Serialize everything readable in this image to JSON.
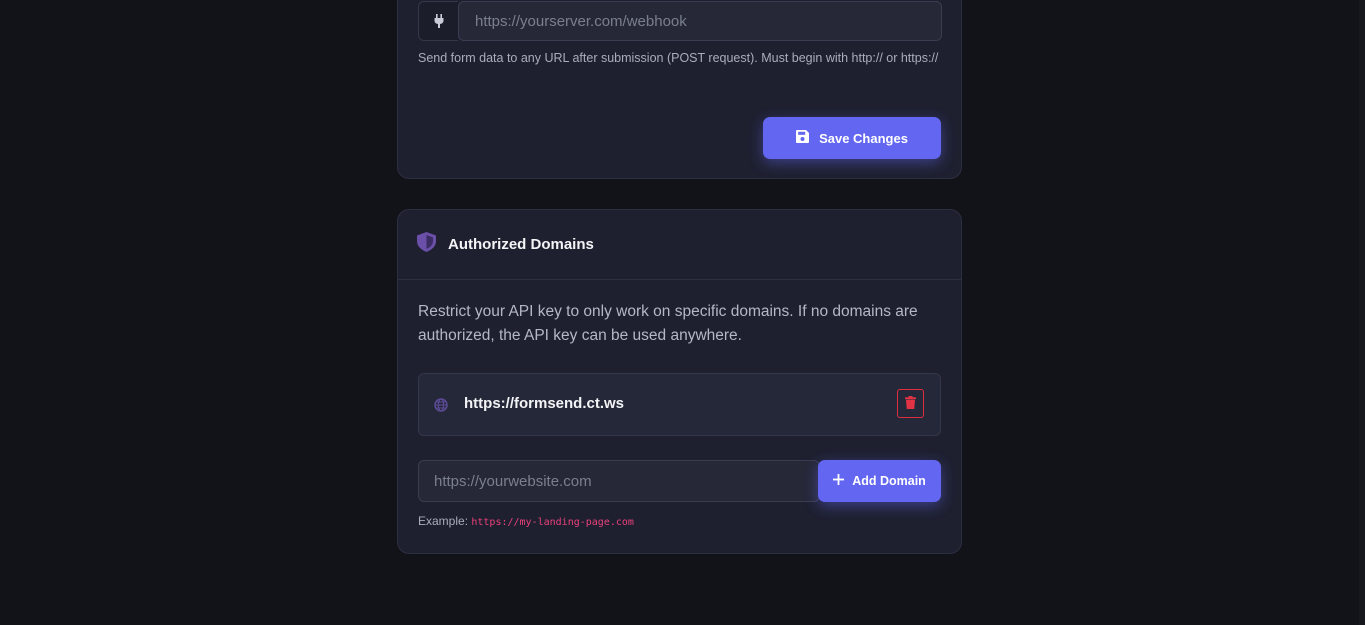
{
  "webhook": {
    "url_placeholder": "https://yourserver.com/webhook",
    "url_value": "",
    "help_text": "Send form data to any URL after submission (POST request). Must begin with http:// or https://",
    "save_label": "Save Changes"
  },
  "domains": {
    "title": "Authorized Domains",
    "description": "Restrict your API key to only work on specific domains. If no domains are authorized, the API key can be used anywhere.",
    "items": [
      {
        "url": "https://formsend.ct.ws"
      }
    ],
    "input_placeholder": "https://yourwebsite.com",
    "input_value": "",
    "add_label": "Add Domain",
    "example_label": "Example:",
    "example_value": "https://my-landing-page.com"
  },
  "colors": {
    "accent": "#6366f1",
    "danger": "#dc2f3d",
    "shield": "#6b4fa8",
    "code": "#ec407a"
  },
  "icons": {
    "plug": "plug-icon",
    "save": "floppy-disk-icon",
    "shield": "shield-icon",
    "globe": "globe-icon",
    "trash": "trash-icon",
    "plus": "plus-icon"
  }
}
